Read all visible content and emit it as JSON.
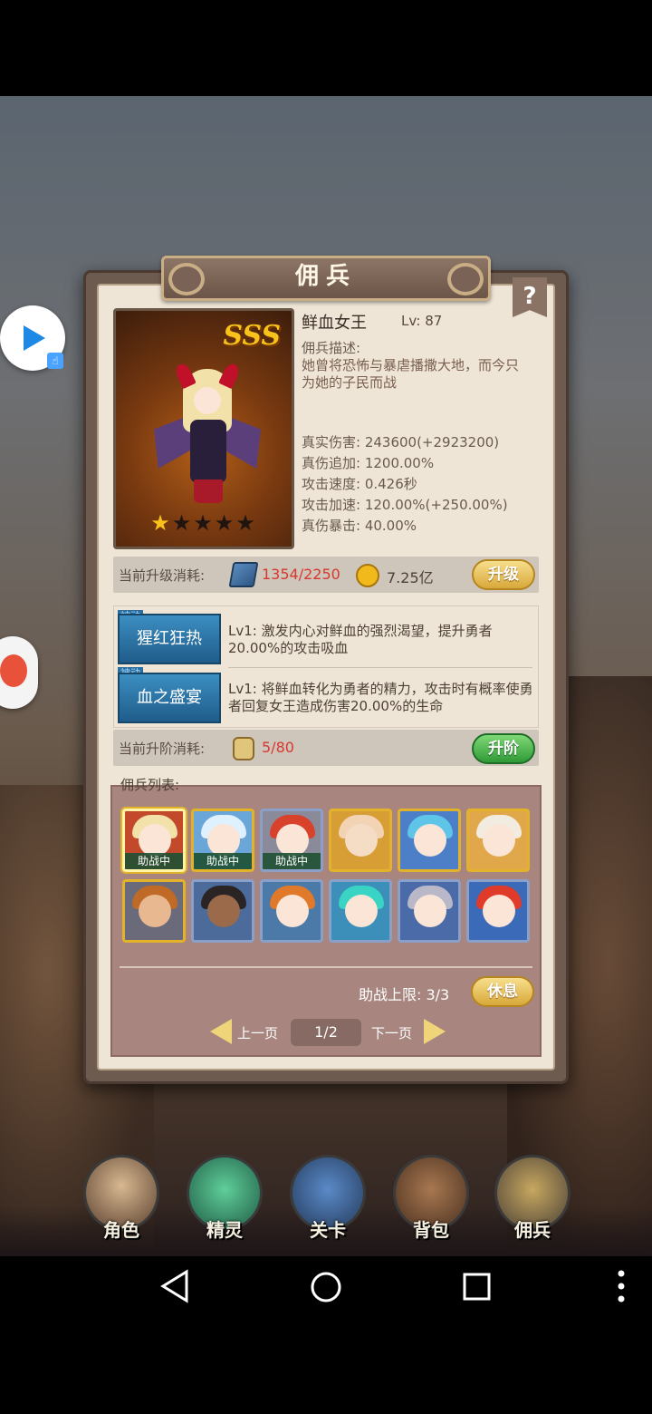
{
  "panel": {
    "title": "佣兵",
    "help": "?"
  },
  "hero": {
    "rank": "SSS",
    "name": "鲜血女王",
    "level": "Lv:  87",
    "stars_filled": 1,
    "stars_total": 5,
    "desc_label": "佣兵描述:",
    "description": "她曾将恐怖与暴虐播撒大地，而今只为她的子民而战",
    "stats": [
      "真实伤害: 243600(+2923200)",
      "真伤追加: 1200.00%",
      "攻击速度: 0.426秒",
      "攻击加速: 120.00%(+250.00%)",
      "真伤暴击: 40.00%"
    ]
  },
  "upgrade": {
    "label": "当前升级消耗:",
    "book_cost": "1354/2250",
    "gold_cost": "7.25亿",
    "button": "升级"
  },
  "skills": [
    {
      "tag": "被动",
      "name": "猩红狂热",
      "desc": "Lv1:  激发内心对鲜血的强烈渴望，提升勇者20.00%的攻击吸血"
    },
    {
      "tag": "被动",
      "name": "血之盛宴",
      "desc": "Lv1:  将鲜血转化为勇者的精力，攻击时有概率使勇者回复女王造成伤害20.00%的生命"
    }
  ],
  "advance": {
    "label": "当前升阶消耗:",
    "cost": "5/80",
    "button": "升阶"
  },
  "mercenary_list": {
    "label": "佣兵列表:",
    "badge": "助战中",
    "assist_limit": "助战上限: 3/3",
    "rest_button": "休息",
    "prev": "上一页",
    "next": "下一页",
    "page": "1/2"
  },
  "bottom_nav": [
    "角色",
    "精灵",
    "关卡",
    "背包",
    "佣兵"
  ],
  "colors": {
    "accent_gold": "#d9a83a",
    "accent_green": "#2f9a37",
    "cost_red": "#d6382e",
    "skill_blue": "#1f5c8a"
  }
}
